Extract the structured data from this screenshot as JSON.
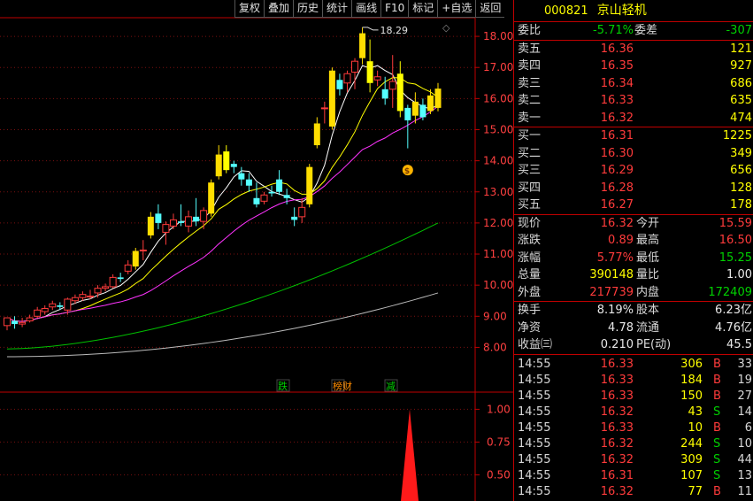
{
  "toolbar": [
    "复权",
    "叠加",
    "历史",
    "统计",
    "画线",
    "F10",
    "标记",
    "+自选",
    "返回"
  ],
  "stock": {
    "code": "000821",
    "name": "京山轻机"
  },
  "chart_data": {
    "type": "candlestick",
    "y_axis_labels": [
      "18.00",
      "17.00",
      "16.00",
      "15.00",
      "14.00",
      "13.00",
      "12.00",
      "11.00",
      "10.00",
      "9.00",
      "8.00"
    ],
    "ylim": [
      7.5,
      18.6
    ],
    "high_marker": "18.29",
    "candles": [
      [
        8.7,
        8.95,
        8.55,
        8.9
      ],
      [
        8.85,
        8.75,
        8.6,
        9.0
      ],
      [
        8.75,
        8.8,
        8.65,
        8.95
      ],
      [
        8.85,
        8.95,
        8.8,
        9.05
      ],
      [
        9.0,
        9.2,
        8.95,
        9.3
      ],
      [
        9.15,
        9.25,
        9.05,
        9.35
      ],
      [
        9.3,
        9.4,
        9.2,
        9.5
      ],
      [
        9.35,
        9.3,
        9.2,
        9.45
      ],
      [
        9.2,
        9.55,
        9.05,
        9.6
      ],
      [
        9.5,
        9.6,
        9.4,
        9.7
      ],
      [
        9.6,
        9.7,
        9.5,
        9.8
      ],
      [
        9.65,
        9.65,
        9.55,
        9.85
      ],
      [
        9.75,
        9.9,
        9.6,
        10.0
      ],
      [
        9.9,
        9.95,
        9.8,
        10.05
      ],
      [
        9.95,
        10.25,
        9.9,
        10.35
      ],
      [
        10.25,
        10.2,
        10.1,
        10.4
      ],
      [
        10.45,
        10.65,
        10.35,
        10.8
      ],
      [
        10.6,
        11.1,
        10.5,
        11.2
      ],
      [
        11.1,
        11.13,
        10.8,
        11.45
      ],
      [
        11.6,
        12.2,
        11.5,
        12.35
      ],
      [
        12.3,
        12.0,
        11.8,
        12.6
      ],
      [
        11.7,
        11.95,
        11.3,
        12.05
      ],
      [
        11.9,
        12.1,
        11.8,
        12.3
      ],
      [
        12.05,
        12.0,
        11.9,
        12.6
      ],
      [
        11.9,
        12.2,
        11.7,
        12.4
      ],
      [
        12.2,
        12.05,
        11.9,
        12.8
      ],
      [
        12.05,
        12.4,
        11.8,
        12.5
      ],
      [
        12.3,
        13.3,
        12.2,
        13.4
      ],
      [
        13.5,
        14.2,
        13.4,
        14.5
      ],
      [
        14.3,
        13.7,
        13.6,
        14.5
      ],
      [
        13.9,
        13.8,
        13.6,
        14.0
      ],
      [
        13.6,
        13.4,
        13.2,
        13.8
      ],
      [
        13.4,
        13.2,
        13.0,
        13.6
      ],
      [
        12.8,
        12.6,
        12.5,
        13.3
      ],
      [
        12.7,
        12.9,
        12.6,
        13.0
      ],
      [
        13.0,
        12.95,
        12.85,
        13.2
      ],
      [
        13.4,
        13.0,
        12.9,
        13.7
      ],
      [
        12.9,
        12.8,
        12.6,
        13.1
      ],
      [
        12.2,
        12.1,
        11.9,
        12.5
      ],
      [
        12.2,
        12.5,
        12.0,
        12.8
      ],
      [
        12.6,
        13.8,
        12.5,
        13.9
      ],
      [
        14.5,
        15.2,
        14.4,
        15.4
      ],
      [
        15.7,
        15.7,
        15.2,
        15.9
      ],
      [
        15.1,
        16.9,
        15.0,
        17.0
      ],
      [
        16.6,
        16.3,
        16.1,
        16.8
      ],
      [
        16.5,
        16.8,
        16.2,
        16.9
      ],
      [
        16.85,
        17.2,
        16.3,
        17.3
      ],
      [
        17.3,
        18.1,
        17.1,
        18.29
      ],
      [
        17.2,
        16.5,
        16.2,
        17.9
      ],
      [
        16.6,
        16.7,
        16.4,
        16.9
      ],
      [
        16.3,
        16.0,
        15.8,
        16.7
      ],
      [
        16.3,
        16.55,
        15.7,
        17.4
      ],
      [
        16.8,
        15.6,
        15.4,
        17.2
      ],
      [
        15.7,
        15.3,
        14.4,
        15.8
      ],
      [
        15.45,
        15.9,
        15.2,
        16.2
      ],
      [
        15.8,
        15.4,
        15.3,
        16.0
      ],
      [
        15.6,
        16.1,
        15.5,
        16.3
      ],
      [
        15.7,
        16.32,
        15.59,
        16.5
      ]
    ],
    "markers": [
      {
        "label": "跌",
        "color": "#00d000"
      },
      {
        "label": "榜财",
        "color": "#ff8c00"
      },
      {
        "label": "减",
        "color": "#00d000"
      }
    ],
    "indicator": {
      "y_axis_labels": [
        "1.00",
        "0.75",
        "0.50"
      ],
      "value": 1.0,
      "ylim": [
        0.3,
        1.05
      ]
    }
  },
  "quote": {
    "weibi": {
      "label": "委比",
      "value": "-5.71%",
      "label2": "委差",
      "value2": "-307"
    },
    "sell": [
      {
        "label": "卖五",
        "price": "16.36",
        "vol": "121"
      },
      {
        "label": "卖四",
        "price": "16.35",
        "vol": "927"
      },
      {
        "label": "卖三",
        "price": "16.34",
        "vol": "686"
      },
      {
        "label": "卖二",
        "price": "16.33",
        "vol": "635"
      },
      {
        "label": "卖一",
        "price": "16.32",
        "vol": "474"
      }
    ],
    "buy": [
      {
        "label": "买一",
        "price": "16.31",
        "vol": "1225"
      },
      {
        "label": "买二",
        "price": "16.30",
        "vol": "349"
      },
      {
        "label": "买三",
        "price": "16.29",
        "vol": "656"
      },
      {
        "label": "买四",
        "price": "16.28",
        "vol": "128"
      },
      {
        "label": "买五",
        "price": "16.27",
        "vol": "178"
      }
    ],
    "stats": [
      {
        "l1": "现价",
        "v1": "16.32",
        "l2": "今开",
        "v2": "15.59",
        "c1": "red",
        "c2": "red"
      },
      {
        "l1": "涨跌",
        "v1": "0.89",
        "l2": "最高",
        "v2": "16.50",
        "c1": "red",
        "c2": "red"
      },
      {
        "l1": "涨幅",
        "v1": "5.77%",
        "l2": "最低",
        "v2": "15.25",
        "c1": "red",
        "c2": "green"
      },
      {
        "l1": "总量",
        "v1": "390148",
        "l2": "量比",
        "v2": "1.00",
        "c1": "yellow",
        "c2": "white"
      },
      {
        "l1": "外盘",
        "v1": "217739",
        "l2": "内盘",
        "v2": "172409",
        "c1": "red",
        "c2": "green"
      }
    ],
    "fund": [
      {
        "l1": "换手",
        "v1": "8.19%",
        "l2": "股本",
        "v2": "6.23亿"
      },
      {
        "l1": "净资",
        "v1": "4.78",
        "l2": "流通",
        "v2": "4.76亿"
      },
      {
        "l1": "收益㈢",
        "v1": "0.210",
        "l2": "PE(动)",
        "v2": "45.5"
      }
    ]
  },
  "ticks": [
    {
      "time": "14:55",
      "price": "16.33",
      "vol": "306",
      "bs": "B",
      "cnt": "33",
      "pc": "red"
    },
    {
      "time": "14:55",
      "price": "16.33",
      "vol": "184",
      "bs": "B",
      "cnt": "19",
      "pc": "red"
    },
    {
      "time": "14:55",
      "price": "16.33",
      "vol": "150",
      "bs": "B",
      "cnt": "27",
      "pc": "red"
    },
    {
      "time": "14:55",
      "price": "16.32",
      "vol": "43",
      "bs": "S",
      "cnt": "14",
      "pc": "red"
    },
    {
      "time": "14:55",
      "price": "16.33",
      "vol": "10",
      "bs": "B",
      "cnt": "6",
      "pc": "red"
    },
    {
      "time": "14:55",
      "price": "16.32",
      "vol": "244",
      "bs": "S",
      "cnt": "10",
      "pc": "red"
    },
    {
      "time": "14:55",
      "price": "16.32",
      "vol": "309",
      "bs": "S",
      "cnt": "44",
      "pc": "red"
    },
    {
      "time": "14:55",
      "price": "16.31",
      "vol": "107",
      "bs": "S",
      "cnt": "13",
      "pc": "red"
    },
    {
      "time": "14:55",
      "price": "16.32",
      "vol": "77",
      "bs": "B",
      "cnt": "11",
      "pc": "red"
    }
  ]
}
